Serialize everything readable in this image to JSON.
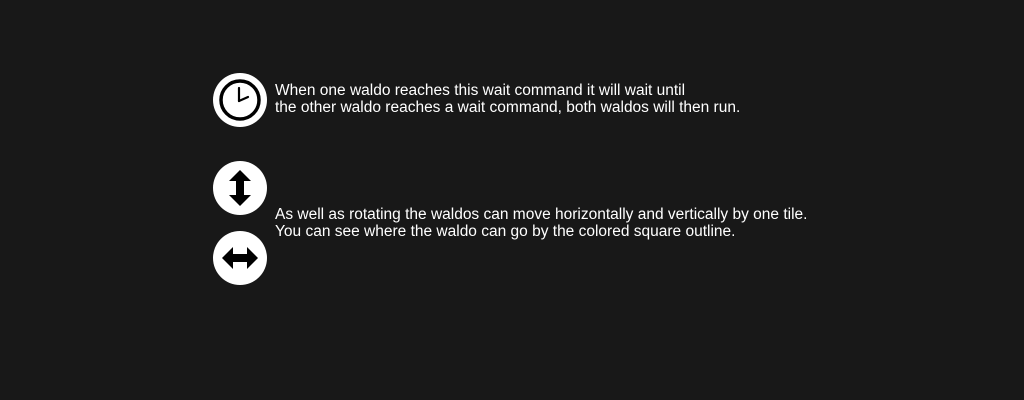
{
  "tutorial": {
    "wait_section": {
      "icon": "clock-icon",
      "lines": [
        "When one waldo reaches this wait command it will wait until",
        "the other waldo reaches a wait command, both waldos will then run."
      ]
    },
    "move_section": {
      "icons": [
        "vertical-move-arrow-icon",
        "horizontal-move-arrow-icon"
      ],
      "lines": [
        "As well as rotating the waldos can move horizontally and vertically by one tile.",
        "You can see where the waldo can go by the colored square outline."
      ]
    }
  },
  "colors": {
    "background": "#181818",
    "text": "#ffffff",
    "icon_fill": "#ffffff",
    "icon_glyph": "#000000"
  }
}
